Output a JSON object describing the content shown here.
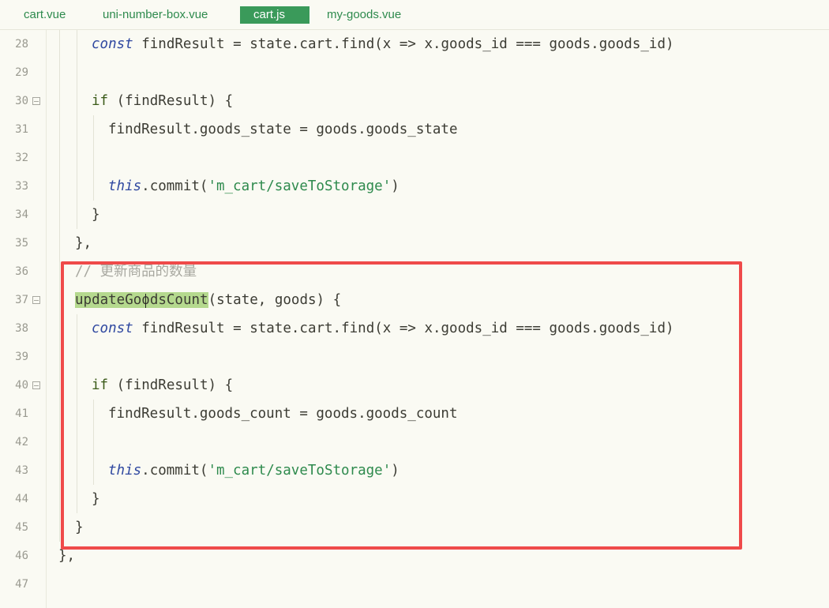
{
  "tabs": [
    {
      "label": "cart.vue",
      "active": false
    },
    {
      "label": "uni-number-box.vue",
      "active": false
    },
    {
      "label": "cart.js",
      "active": true
    },
    {
      "label": "my-goods.vue",
      "active": false
    }
  ],
  "lines": [
    {
      "num": "28",
      "fold": false
    },
    {
      "num": "29",
      "fold": false
    },
    {
      "num": "30",
      "fold": true
    },
    {
      "num": "31",
      "fold": false
    },
    {
      "num": "32",
      "fold": false
    },
    {
      "num": "33",
      "fold": false
    },
    {
      "num": "34",
      "fold": false
    },
    {
      "num": "35",
      "fold": false
    },
    {
      "num": "36",
      "fold": false
    },
    {
      "num": "37",
      "fold": true
    },
    {
      "num": "38",
      "fold": false
    },
    {
      "num": "39",
      "fold": false
    },
    {
      "num": "40",
      "fold": true
    },
    {
      "num": "41",
      "fold": false
    },
    {
      "num": "42",
      "fold": false
    },
    {
      "num": "43",
      "fold": false
    },
    {
      "num": "44",
      "fold": false
    },
    {
      "num": "45",
      "fold": false
    },
    {
      "num": "46",
      "fold": false
    },
    {
      "num": "47",
      "fold": false
    }
  ],
  "code": {
    "l28_kw": "const",
    "l28_rest": " findResult = state.cart.find(x => x.goods_id === goods.goods_id)",
    "l30_kw": "if",
    "l30_rest": " (findResult) {",
    "l31": "findResult.goods_state = goods.goods_state",
    "l33_this": "this",
    "l33_mid": ".commit(",
    "l33_str": "'m_cart/saveToStorage'",
    "l33_end": ")",
    "l34": "}",
    "l35": "},",
    "l36": "// 更新商品的数量",
    "l37_fn": "updateGoodsCount",
    "l37_rest": "(state, goods) {",
    "l38_kw": "const",
    "l38_rest": " findResult = state.cart.find(x => x.goods_id === goods.goods_id)",
    "l40_kw": "if",
    "l40_rest": " (findResult) {",
    "l41": "findResult.goods_count = goods.goods_count",
    "l43_this": "this",
    "l43_mid": ".commit(",
    "l43_str": "'m_cart/saveToStorage'",
    "l43_end": ")",
    "l44": "}",
    "l45": "}",
    "l46": "},"
  },
  "colors": {
    "keyword": "#2f48a0",
    "string": "#2e8a4d",
    "comment": "#a8a8a0",
    "highlight": "#b5d98e",
    "box": "#ef4a4a",
    "active_tab": "#3a9a5a"
  }
}
